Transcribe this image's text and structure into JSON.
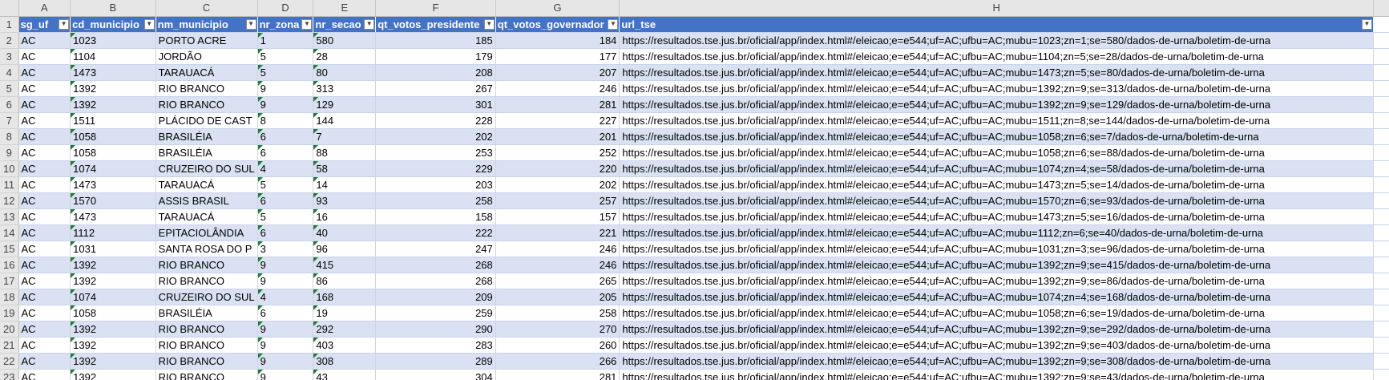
{
  "columns": [
    "A",
    "B",
    "C",
    "D",
    "E",
    "F",
    "G",
    "H"
  ],
  "headers": [
    "sg_uf",
    "cd_municipio",
    "nm_municipio",
    "nr_zona",
    "nr_secao",
    "qt_votos_presidente",
    "qt_votos_governador",
    "url_tse"
  ],
  "header_row_number": "1",
  "rows": [
    {
      "n": "2",
      "uf": "AC",
      "cd": "1023",
      "nm": "PORTO ACRE",
      "zona": "1",
      "secao": "580",
      "pres": "185",
      "gov": "184",
      "url": "https://resultados.tse.jus.br/oficial/app/index.html#/eleicao;e=e544;uf=AC;ufbu=AC;mubu=1023;zn=1;se=580/dados-de-urna/boletim-de-urna"
    },
    {
      "n": "3",
      "uf": "AC",
      "cd": "1104",
      "nm": "JORDÃO",
      "zona": "5",
      "secao": "28",
      "pres": "179",
      "gov": "177",
      "url": "https://resultados.tse.jus.br/oficial/app/index.html#/eleicao;e=e544;uf=AC;ufbu=AC;mubu=1104;zn=5;se=28/dados-de-urna/boletim-de-urna"
    },
    {
      "n": "4",
      "uf": "AC",
      "cd": "1473",
      "nm": "TARAUACÁ",
      "zona": "5",
      "secao": "80",
      "pres": "208",
      "gov": "207",
      "url": "https://resultados.tse.jus.br/oficial/app/index.html#/eleicao;e=e544;uf=AC;ufbu=AC;mubu=1473;zn=5;se=80/dados-de-urna/boletim-de-urna"
    },
    {
      "n": "5",
      "uf": "AC",
      "cd": "1392",
      "nm": "RIO BRANCO",
      "zona": "9",
      "secao": "313",
      "pres": "267",
      "gov": "246",
      "url": "https://resultados.tse.jus.br/oficial/app/index.html#/eleicao;e=e544;uf=AC;ufbu=AC;mubu=1392;zn=9;se=313/dados-de-urna/boletim-de-urna"
    },
    {
      "n": "6",
      "uf": "AC",
      "cd": "1392",
      "nm": "RIO BRANCO",
      "zona": "9",
      "secao": "129",
      "pres": "301",
      "gov": "281",
      "url": "https://resultados.tse.jus.br/oficial/app/index.html#/eleicao;e=e544;uf=AC;ufbu=AC;mubu=1392;zn=9;se=129/dados-de-urna/boletim-de-urna"
    },
    {
      "n": "7",
      "uf": "AC",
      "cd": "1511",
      "nm": "PLÁCIDO DE CAST",
      "zona": "8",
      "secao": "144",
      "pres": "228",
      "gov": "227",
      "url": "https://resultados.tse.jus.br/oficial/app/index.html#/eleicao;e=e544;uf=AC;ufbu=AC;mubu=1511;zn=8;se=144/dados-de-urna/boletim-de-urna"
    },
    {
      "n": "8",
      "uf": "AC",
      "cd": "1058",
      "nm": "BRASILÉIA",
      "zona": "6",
      "secao": "7",
      "pres": "202",
      "gov": "201",
      "url": "https://resultados.tse.jus.br/oficial/app/index.html#/eleicao;e=e544;uf=AC;ufbu=AC;mubu=1058;zn=6;se=7/dados-de-urna/boletim-de-urna"
    },
    {
      "n": "9",
      "uf": "AC",
      "cd": "1058",
      "nm": "BRASILÉIA",
      "zona": "6",
      "secao": "88",
      "pres": "253",
      "gov": "252",
      "url": "https://resultados.tse.jus.br/oficial/app/index.html#/eleicao;e=e544;uf=AC;ufbu=AC;mubu=1058;zn=6;se=88/dados-de-urna/boletim-de-urna"
    },
    {
      "n": "10",
      "uf": "AC",
      "cd": "1074",
      "nm": "CRUZEIRO DO SUL",
      "zona": "4",
      "secao": "58",
      "pres": "229",
      "gov": "220",
      "url": "https://resultados.tse.jus.br/oficial/app/index.html#/eleicao;e=e544;uf=AC;ufbu=AC;mubu=1074;zn=4;se=58/dados-de-urna/boletim-de-urna"
    },
    {
      "n": "11",
      "uf": "AC",
      "cd": "1473",
      "nm": "TARAUACÁ",
      "zona": "5",
      "secao": "14",
      "pres": "203",
      "gov": "202",
      "url": "https://resultados.tse.jus.br/oficial/app/index.html#/eleicao;e=e544;uf=AC;ufbu=AC;mubu=1473;zn=5;se=14/dados-de-urna/boletim-de-urna"
    },
    {
      "n": "12",
      "uf": "AC",
      "cd": "1570",
      "nm": "ASSIS BRASIL",
      "zona": "6",
      "secao": "93",
      "pres": "258",
      "gov": "257",
      "url": "https://resultados.tse.jus.br/oficial/app/index.html#/eleicao;e=e544;uf=AC;ufbu=AC;mubu=1570;zn=6;se=93/dados-de-urna/boletim-de-urna"
    },
    {
      "n": "13",
      "uf": "AC",
      "cd": "1473",
      "nm": "TARAUACÁ",
      "zona": "5",
      "secao": "16",
      "pres": "158",
      "gov": "157",
      "url": "https://resultados.tse.jus.br/oficial/app/index.html#/eleicao;e=e544;uf=AC;ufbu=AC;mubu=1473;zn=5;se=16/dados-de-urna/boletim-de-urna"
    },
    {
      "n": "14",
      "uf": "AC",
      "cd": "1112",
      "nm": "EPITACIOLÂNDIA",
      "zona": "6",
      "secao": "40",
      "pres": "222",
      "gov": "221",
      "url": "https://resultados.tse.jus.br/oficial/app/index.html#/eleicao;e=e544;uf=AC;ufbu=AC;mubu=1112;zn=6;se=40/dados-de-urna/boletim-de-urna"
    },
    {
      "n": "15",
      "uf": "AC",
      "cd": "1031",
      "nm": "SANTA ROSA DO P",
      "zona": "3",
      "secao": "96",
      "pres": "247",
      "gov": "246",
      "url": "https://resultados.tse.jus.br/oficial/app/index.html#/eleicao;e=e544;uf=AC;ufbu=AC;mubu=1031;zn=3;se=96/dados-de-urna/boletim-de-urna"
    },
    {
      "n": "16",
      "uf": "AC",
      "cd": "1392",
      "nm": "RIO BRANCO",
      "zona": "9",
      "secao": "415",
      "pres": "268",
      "gov": "246",
      "url": "https://resultados.tse.jus.br/oficial/app/index.html#/eleicao;e=e544;uf=AC;ufbu=AC;mubu=1392;zn=9;se=415/dados-de-urna/boletim-de-urna"
    },
    {
      "n": "17",
      "uf": "AC",
      "cd": "1392",
      "nm": "RIO BRANCO",
      "zona": "9",
      "secao": "86",
      "pres": "268",
      "gov": "265",
      "url": "https://resultados.tse.jus.br/oficial/app/index.html#/eleicao;e=e544;uf=AC;ufbu=AC;mubu=1392;zn=9;se=86/dados-de-urna/boletim-de-urna"
    },
    {
      "n": "18",
      "uf": "AC",
      "cd": "1074",
      "nm": "CRUZEIRO DO SUL",
      "zona": "4",
      "secao": "168",
      "pres": "209",
      "gov": "205",
      "url": "https://resultados.tse.jus.br/oficial/app/index.html#/eleicao;e=e544;uf=AC;ufbu=AC;mubu=1074;zn=4;se=168/dados-de-urna/boletim-de-urna"
    },
    {
      "n": "19",
      "uf": "AC",
      "cd": "1058",
      "nm": "BRASILÉIA",
      "zona": "6",
      "secao": "19",
      "pres": "259",
      "gov": "258",
      "url": "https://resultados.tse.jus.br/oficial/app/index.html#/eleicao;e=e544;uf=AC;ufbu=AC;mubu=1058;zn=6;se=19/dados-de-urna/boletim-de-urna"
    },
    {
      "n": "20",
      "uf": "AC",
      "cd": "1392",
      "nm": "RIO BRANCO",
      "zona": "9",
      "secao": "292",
      "pres": "290",
      "gov": "270",
      "url": "https://resultados.tse.jus.br/oficial/app/index.html#/eleicao;e=e544;uf=AC;ufbu=AC;mubu=1392;zn=9;se=292/dados-de-urna/boletim-de-urna"
    },
    {
      "n": "21",
      "uf": "AC",
      "cd": "1392",
      "nm": "RIO BRANCO",
      "zona": "9",
      "secao": "403",
      "pres": "283",
      "gov": "260",
      "url": "https://resultados.tse.jus.br/oficial/app/index.html#/eleicao;e=e544;uf=AC;ufbu=AC;mubu=1392;zn=9;se=403/dados-de-urna/boletim-de-urna"
    },
    {
      "n": "22",
      "uf": "AC",
      "cd": "1392",
      "nm": "RIO BRANCO",
      "zona": "9",
      "secao": "308",
      "pres": "289",
      "gov": "266",
      "url": "https://resultados.tse.jus.br/oficial/app/index.html#/eleicao;e=e544;uf=AC;ufbu=AC;mubu=1392;zn=9;se=308/dados-de-urna/boletim-de-urna"
    },
    {
      "n": "23",
      "uf": "AC",
      "cd": "1392",
      "nm": "RIO BRANCO",
      "zona": "9",
      "secao": "43",
      "pres": "304",
      "gov": "281",
      "url": "https://resultados.tse.jus.br/oficial/app/index.html#/eleicao;e=e544;uf=AC;ufbu=AC;mubu=1392;zn=9;se=43/dados-de-urna/boletim-de-urna"
    }
  ],
  "icons": {
    "filter": "filter-dropdown-icon"
  },
  "colors": {
    "header_fill": "#4472c4",
    "band_fill": "#d9e1f2",
    "grid_header": "#e6e6e6",
    "text_number_indicator": "#1e7b34"
  }
}
